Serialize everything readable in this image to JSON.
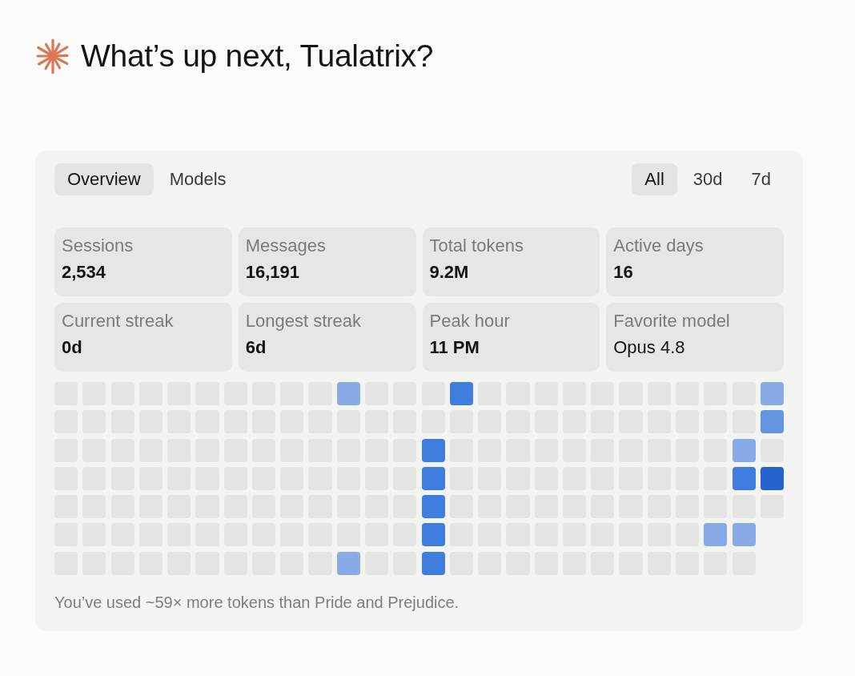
{
  "greeting": {
    "text": "What’s up next, Tualatrix?"
  },
  "tabs": [
    {
      "label": "Overview",
      "selected": true
    },
    {
      "label": "Models",
      "selected": false
    }
  ],
  "ranges": [
    {
      "label": "All",
      "selected": true
    },
    {
      "label": "30d",
      "selected": false
    },
    {
      "label": "7d",
      "selected": false
    }
  ],
  "stats": [
    {
      "label": "Sessions",
      "value": "2,534",
      "kind": "number"
    },
    {
      "label": "Messages",
      "value": "16,191",
      "kind": "number"
    },
    {
      "label": "Total tokens",
      "value": "9.2M",
      "kind": "number"
    },
    {
      "label": "Active days",
      "value": "16",
      "kind": "number"
    },
    {
      "label": "Current streak",
      "value": "0d",
      "kind": "number"
    },
    {
      "label": "Longest streak",
      "value": "6d",
      "kind": "number"
    },
    {
      "label": "Peak hour",
      "value": "11 PM",
      "kind": "number"
    },
    {
      "label": "Favorite model",
      "value": "Opus 4.8",
      "kind": "text"
    }
  ],
  "heatmap": {
    "weeks": [
      [
        {
          "color": "#e4e4e2"
        },
        {
          "color": "#e4e4e2"
        },
        {
          "color": "#e4e4e2"
        },
        {
          "color": "#e4e4e2"
        },
        {
          "color": "#e4e4e2"
        },
        {
          "color": "#e4e4e2"
        },
        {
          "color": "#e4e4e2"
        }
      ],
      [
        {
          "color": "#e4e4e2"
        },
        {
          "color": "#e4e4e2"
        },
        {
          "color": "#e4e4e2"
        },
        {
          "color": "#e4e4e2"
        },
        {
          "color": "#e4e4e2"
        },
        {
          "color": "#e4e4e2"
        },
        {
          "color": "#e4e4e2"
        }
      ],
      [
        {
          "color": "#e4e4e2"
        },
        {
          "color": "#e4e4e2"
        },
        {
          "color": "#e4e4e2"
        },
        {
          "color": "#e4e4e2"
        },
        {
          "color": "#e4e4e2"
        },
        {
          "color": "#e4e4e2"
        },
        {
          "color": "#e4e4e2"
        }
      ],
      [
        {
          "color": "#e4e4e2"
        },
        {
          "color": "#e4e4e2"
        },
        {
          "color": "#e4e4e2"
        },
        {
          "color": "#e4e4e2"
        },
        {
          "color": "#e4e4e2"
        },
        {
          "color": "#e4e4e2"
        },
        {
          "color": "#e4e4e2"
        }
      ],
      [
        {
          "color": "#e4e4e2"
        },
        {
          "color": "#e4e4e2"
        },
        {
          "color": "#e4e4e2"
        },
        {
          "color": "#e4e4e2"
        },
        {
          "color": "#e4e4e2"
        },
        {
          "color": "#e4e4e2"
        },
        {
          "color": "#e4e4e2"
        }
      ],
      [
        {
          "color": "#e4e4e2"
        },
        {
          "color": "#e4e4e2"
        },
        {
          "color": "#e4e4e2"
        },
        {
          "color": "#e4e4e2"
        },
        {
          "color": "#e4e4e2"
        },
        {
          "color": "#e4e4e2"
        },
        {
          "color": "#e4e4e2"
        }
      ],
      [
        {
          "color": "#e4e4e2"
        },
        {
          "color": "#e4e4e2"
        },
        {
          "color": "#e4e4e2"
        },
        {
          "color": "#e4e4e2"
        },
        {
          "color": "#e4e4e2"
        },
        {
          "color": "#e4e4e2"
        },
        {
          "color": "#e4e4e2"
        }
      ],
      [
        {
          "color": "#e4e4e2"
        },
        {
          "color": "#e4e4e2"
        },
        {
          "color": "#e4e4e2"
        },
        {
          "color": "#e4e4e2"
        },
        {
          "color": "#e4e4e2"
        },
        {
          "color": "#e4e4e2"
        },
        {
          "color": "#e4e4e2"
        }
      ],
      [
        {
          "color": "#e4e4e2"
        },
        {
          "color": "#e4e4e2"
        },
        {
          "color": "#e4e4e2"
        },
        {
          "color": "#e4e4e2"
        },
        {
          "color": "#e4e4e2"
        },
        {
          "color": "#e4e4e2"
        },
        {
          "color": "#e4e4e2"
        }
      ],
      [
        {
          "color": "#e4e4e2"
        },
        {
          "color": "#e4e4e2"
        },
        {
          "color": "#e4e4e2"
        },
        {
          "color": "#e4e4e2"
        },
        {
          "color": "#e4e4e2"
        },
        {
          "color": "#e4e4e2"
        },
        {
          "color": "#e4e4e2"
        }
      ],
      [
        {
          "color": "#88abe8"
        },
        {
          "color": "#e4e4e2"
        },
        {
          "color": "#e4e4e2"
        },
        {
          "color": "#e4e4e2"
        },
        {
          "color": "#e4e4e2"
        },
        {
          "color": "#e4e4e2"
        },
        {
          "color": "#88abe8"
        }
      ],
      [
        {
          "color": "#e4e4e2"
        },
        {
          "color": "#e4e4e2"
        },
        {
          "color": "#e4e4e2"
        },
        {
          "color": "#e4e4e2"
        },
        {
          "color": "#e4e4e2"
        },
        {
          "color": "#e4e4e2"
        },
        {
          "color": "#e4e4e2"
        }
      ],
      [
        {
          "color": "#e4e4e2"
        },
        {
          "color": "#e4e4e2"
        },
        {
          "color": "#e4e4e2"
        },
        {
          "color": "#e4e4e2"
        },
        {
          "color": "#e4e4e2"
        },
        {
          "color": "#e4e4e2"
        },
        {
          "color": "#e4e4e2"
        }
      ],
      [
        {
          "color": "#e4e4e2"
        },
        {
          "color": "#e4e4e2"
        },
        {
          "color": "#3f7ddf"
        },
        {
          "color": "#3f7ddf"
        },
        {
          "color": "#3f7ddf"
        },
        {
          "color": "#3f7ddf"
        },
        {
          "color": "#3f7ddf"
        }
      ],
      [
        {
          "color": "#3f7ddf"
        },
        {
          "color": "#e4e4e2"
        },
        {
          "color": "#e4e4e2"
        },
        {
          "color": "#e4e4e2"
        },
        {
          "color": "#e4e4e2"
        },
        {
          "color": "#e4e4e2"
        },
        {
          "color": "#e4e4e2"
        }
      ],
      [
        {
          "color": "#e4e4e2"
        },
        {
          "color": "#e4e4e2"
        },
        {
          "color": "#e4e4e2"
        },
        {
          "color": "#e4e4e2"
        },
        {
          "color": "#e4e4e2"
        },
        {
          "color": "#e4e4e2"
        },
        {
          "color": "#e4e4e2"
        }
      ],
      [
        {
          "color": "#e4e4e2"
        },
        {
          "color": "#e4e4e2"
        },
        {
          "color": "#e4e4e2"
        },
        {
          "color": "#e4e4e2"
        },
        {
          "color": "#e4e4e2"
        },
        {
          "color": "#e4e4e2"
        },
        {
          "color": "#e4e4e2"
        }
      ],
      [
        {
          "color": "#e4e4e2"
        },
        {
          "color": "#e4e4e2"
        },
        {
          "color": "#e4e4e2"
        },
        {
          "color": "#e4e4e2"
        },
        {
          "color": "#e4e4e2"
        },
        {
          "color": "#e4e4e2"
        },
        {
          "color": "#e4e4e2"
        }
      ],
      [
        {
          "color": "#e4e4e2"
        },
        {
          "color": "#e4e4e2"
        },
        {
          "color": "#e4e4e2"
        },
        {
          "color": "#e4e4e2"
        },
        {
          "color": "#e4e4e2"
        },
        {
          "color": "#e4e4e2"
        },
        {
          "color": "#e4e4e2"
        }
      ],
      [
        {
          "color": "#e4e4e2"
        },
        {
          "color": "#e4e4e2"
        },
        {
          "color": "#e4e4e2"
        },
        {
          "color": "#e4e4e2"
        },
        {
          "color": "#e4e4e2"
        },
        {
          "color": "#e4e4e2"
        },
        {
          "color": "#e4e4e2"
        }
      ],
      [
        {
          "color": "#e4e4e2"
        },
        {
          "color": "#e4e4e2"
        },
        {
          "color": "#e4e4e2"
        },
        {
          "color": "#e4e4e2"
        },
        {
          "color": "#e4e4e2"
        },
        {
          "color": "#e4e4e2"
        },
        {
          "color": "#e4e4e2"
        }
      ],
      [
        {
          "color": "#e4e4e2"
        },
        {
          "color": "#e4e4e2"
        },
        {
          "color": "#e4e4e2"
        },
        {
          "color": "#e4e4e2"
        },
        {
          "color": "#e4e4e2"
        },
        {
          "color": "#e4e4e2"
        },
        {
          "color": "#e4e4e2"
        }
      ],
      [
        {
          "color": "#e4e4e2"
        },
        {
          "color": "#e4e4e2"
        },
        {
          "color": "#e4e4e2"
        },
        {
          "color": "#e4e4e2"
        },
        {
          "color": "#e4e4e2"
        },
        {
          "color": "#e4e4e2"
        },
        {
          "color": "#e4e4e2"
        }
      ],
      [
        {
          "color": "#e4e4e2"
        },
        {
          "color": "#e4e4e2"
        },
        {
          "color": "#e4e4e2"
        },
        {
          "color": "#e4e4e2"
        },
        {
          "color": "#e4e4e2"
        },
        {
          "color": "#88abe8"
        },
        {
          "color": "#e4e4e2"
        }
      ],
      [
        {
          "color": "#e4e4e2"
        },
        {
          "color": "#e4e4e2"
        },
        {
          "color": "#88abe8"
        },
        {
          "color": "#3f7ddf"
        },
        {
          "color": "#e4e4e2"
        },
        {
          "color": "#88abe8"
        },
        {
          "color": "#e4e4e2"
        }
      ],
      [
        {
          "color": "#88abe8"
        },
        {
          "color": "#6495e0"
        },
        {
          "color": "#e4e4e2"
        },
        {
          "color": "#2563cc"
        },
        {
          "color": "#e4e4e2"
        }
      ]
    ]
  },
  "footnote": "You’ve used ~59× more tokens than Pride and Prejudice."
}
